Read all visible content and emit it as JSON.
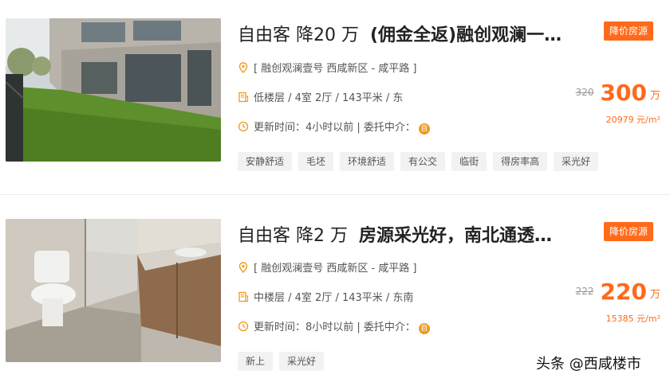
{
  "listings": [
    {
      "title_prefix": "自由客 降20 万",
      "title_main": "(佣金全返)融创观澜一…",
      "badge": "降价房源",
      "location": "[ 融创观澜壹号 西咸新区 - 咸平路 ]",
      "info": "低楼层 / 4室 2厅 / 143平米 / 东",
      "update": "更新时间：4小时以前 | 委托中介：",
      "fav_icon_text": "自",
      "old_price": "320",
      "price": "300",
      "price_unit": "万",
      "unit_price": "20979 元/m²",
      "tags": [
        "安静舒适",
        "毛坯",
        "环境舒适",
        "有公交",
        "临街",
        "得房率高",
        "采光好"
      ],
      "photo": "lawn-building-photo"
    },
    {
      "title_prefix": "自由客 降2 万",
      "title_main": "房源采光好，南北通透…",
      "badge": "降价房源",
      "location": "[ 融创观澜壹号 西咸新区 - 咸平路 ]",
      "info": "中楼层 / 4室 2厅 / 143平米 / 东南",
      "update": "更新时间：8小时以前 | 委托中介：",
      "fav_icon_text": "自",
      "old_price": "222",
      "price": "220",
      "price_unit": "万",
      "unit_price": "15385 元/m²",
      "tags": [
        "新上",
        "采光好"
      ],
      "photo": "bathroom-photo"
    }
  ],
  "watermark": "头条 @西咸楼市",
  "colors": {
    "accent": "#ff6a1a",
    "tag_bg": "#f2f2f2"
  }
}
